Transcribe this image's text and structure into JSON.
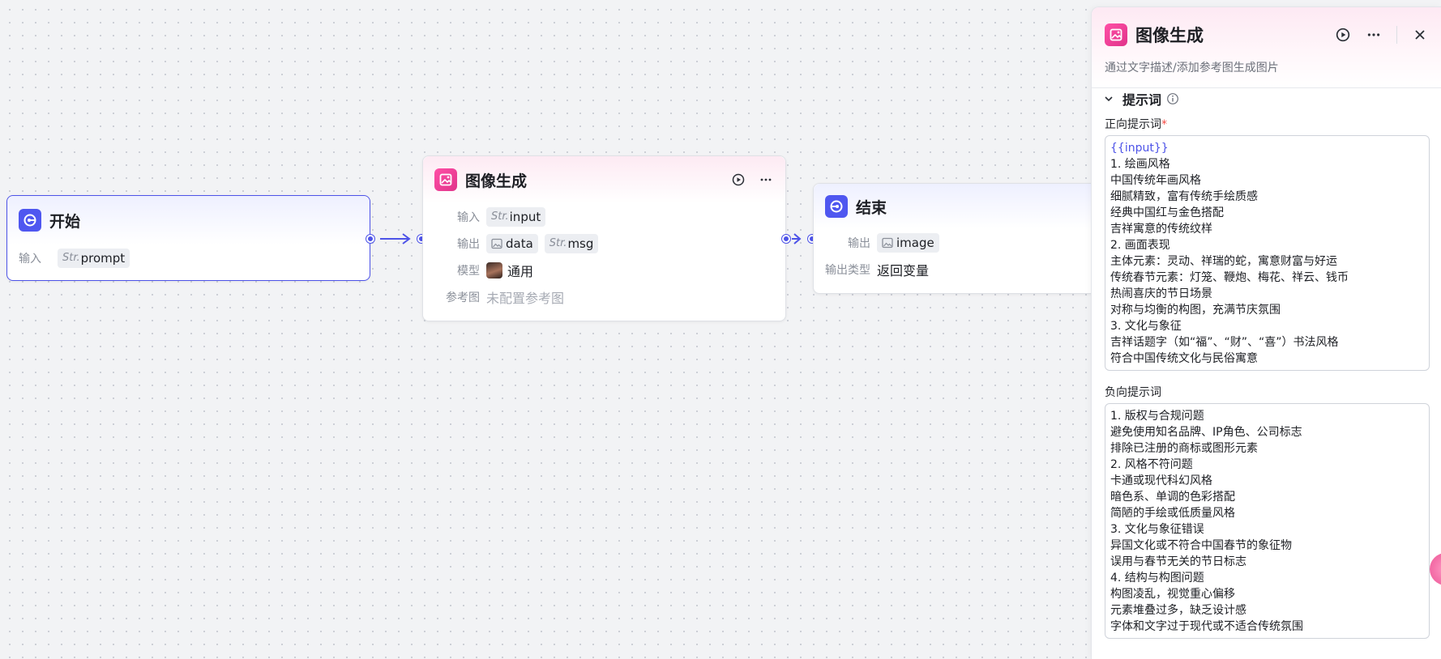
{
  "colors": {
    "accent": "#4d53e8",
    "node_pink": "#e0338a",
    "required": "#f54a45"
  },
  "start_node": {
    "title": "开始",
    "icon": "start-icon",
    "rows": [
      {
        "label": "输入",
        "tags": [
          {
            "type": "Str.",
            "name": "prompt"
          }
        ]
      }
    ]
  },
  "image_node": {
    "title": "图像生成",
    "icon": "image-generate-icon",
    "rows": {
      "input": {
        "label": "输入",
        "type": "Str.",
        "name": "input"
      },
      "output": {
        "label": "输出",
        "tag1": "data",
        "tag2_type": "Str.",
        "tag2": "msg"
      },
      "model": {
        "label": "模型",
        "value": "通用"
      },
      "ref": {
        "label": "参考图",
        "value": "未配置参考图"
      }
    }
  },
  "end_node": {
    "title": "结束",
    "icon": "end-icon",
    "rows": {
      "output": {
        "label": "输出",
        "tag": "image"
      },
      "output_type": {
        "label": "输出类型",
        "value": "返回变量"
      }
    }
  },
  "panel": {
    "title": "图像生成",
    "description": "通过文字描述/添加参考图生成图片",
    "section": "提示词",
    "positive_label": "正向提示词",
    "required_mark": "*",
    "positive_lines": [
      "{{input}}",
      "1. 绘画风格",
      "中国传统年画风格",
      "细腻精致，富有传统手绘质感",
      "经典中国红与金色搭配",
      "吉祥寓意的传统纹样",
      "2. 画面表现",
      "主体元素：灵动、祥瑞的蛇，寓意财富与好运",
      "传统春节元素：灯笼、鞭炮、梅花、祥云、钱币",
      "热闹喜庆的节日场景",
      "对称与均衡的构图，充满节庆氛围",
      "3. 文化与象征",
      "吉祥话题字（如“福”、“财”、“喜”）书法风格",
      "符合中国传统文化与民俗寓意"
    ],
    "negative_label": "负向提示词",
    "negative_lines": [
      "1. 版权与合规问题",
      "避免使用知名品牌、IP角色、公司标志",
      "排除已注册的商标或图形元素",
      "2. 风格不符问题",
      "卡通或现代科幻风格",
      "暗色系、单调的色彩搭配",
      "简陋的手绘或低质量风格",
      "3. 文化与象征错误",
      "异国文化或不符合中国春节的象征物",
      "误用与春节无关的节日标志",
      "4. 结构与构图问题",
      "构图凌乱，视觉重心偏移",
      "元素堆叠过多，缺乏设计感",
      "字体和文字过于现代或不适合传统氛围"
    ]
  }
}
